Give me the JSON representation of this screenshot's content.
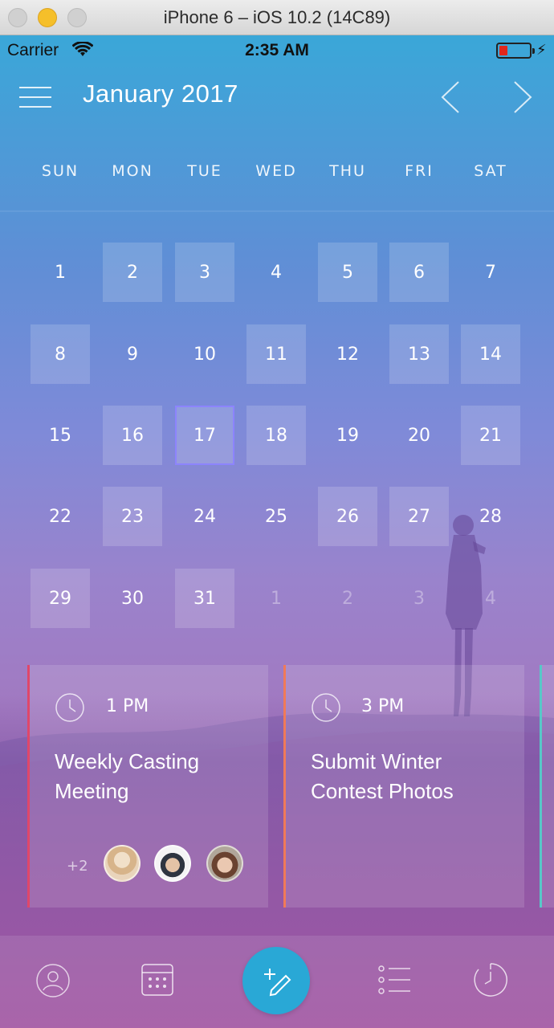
{
  "window": {
    "title": "iPhone 6 – iOS 10.2 (14C89)"
  },
  "status_bar": {
    "carrier": "Carrier",
    "time": "2:35 AM",
    "battery_color": "#e1261c"
  },
  "header": {
    "month_title": "January 2017"
  },
  "weekdays": [
    "SUN",
    "MON",
    "TUE",
    "WED",
    "THU",
    "FRI",
    "SAT"
  ],
  "calendar": {
    "today": "17",
    "weeks": [
      [
        {
          "d": "1"
        },
        {
          "d": "2",
          "hl": true
        },
        {
          "d": "3",
          "hl": true
        },
        {
          "d": "4"
        },
        {
          "d": "5",
          "hl": true
        },
        {
          "d": "6",
          "hl": true
        },
        {
          "d": "7"
        }
      ],
      [
        {
          "d": "8",
          "hl": true
        },
        {
          "d": "9"
        },
        {
          "d": "10"
        },
        {
          "d": "11",
          "hl": true
        },
        {
          "d": "12"
        },
        {
          "d": "13",
          "hl": true
        },
        {
          "d": "14",
          "hl": true
        }
      ],
      [
        {
          "d": "15"
        },
        {
          "d": "16",
          "hl": true
        },
        {
          "d": "17",
          "hl": true,
          "today": true
        },
        {
          "d": "18",
          "hl": true
        },
        {
          "d": "19"
        },
        {
          "d": "20"
        },
        {
          "d": "21",
          "hl": true
        }
      ],
      [
        {
          "d": "22"
        },
        {
          "d": "23",
          "hl": true
        },
        {
          "d": "24"
        },
        {
          "d": "25"
        },
        {
          "d": "26",
          "hl": true
        },
        {
          "d": "27",
          "hl": true
        },
        {
          "d": "28"
        }
      ],
      [
        {
          "d": "29",
          "hl": true
        },
        {
          "d": "30"
        },
        {
          "d": "31",
          "hl": true
        },
        {
          "d": "1",
          "other": true
        },
        {
          "d": "2",
          "other": true
        },
        {
          "d": "3",
          "other": true
        },
        {
          "d": "4",
          "other": true
        }
      ]
    ]
  },
  "events": [
    {
      "time": "1 PM",
      "title_line1": "Weekly Casting",
      "title_line2": "Meeting",
      "accent": "#e0476a",
      "more_attendees": "+2"
    },
    {
      "time": "3 PM",
      "title_line1": "Submit Winter",
      "title_line2": "Contest Photos",
      "accent": "#f07a58"
    }
  ],
  "tabbar": {
    "items": [
      "profile-icon",
      "calendar-icon",
      "add-event-icon",
      "list-icon",
      "history-icon"
    ],
    "fab_color": "#29a8d6"
  }
}
